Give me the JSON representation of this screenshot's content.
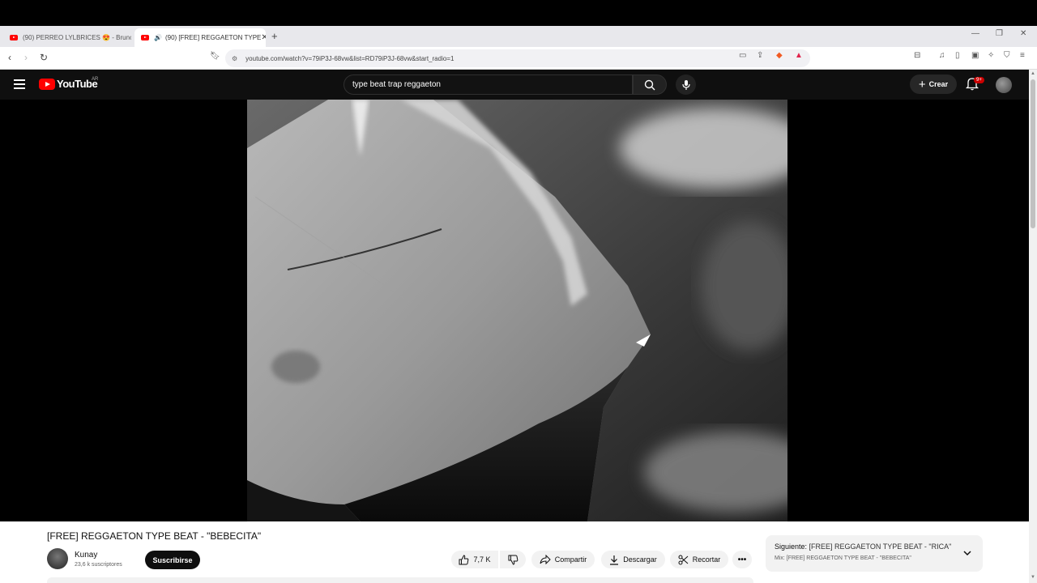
{
  "browser": {
    "tabs": [
      {
        "label": "(90) PERREO LYLBRICES 😍 - Bruno",
        "active": false
      },
      {
        "label": "(90) [FREE] REGGAETON TYPE",
        "active": true
      }
    ],
    "new_tab": "+",
    "url": "youtube.com/watch?v=79iP3J-68vw&list=RD79iP3J-68vw&start_radio=1"
  },
  "youtube": {
    "country": "AR",
    "logo_text": "YouTube",
    "search_query": "type beat trap reggaeton",
    "create_label": "Crear",
    "notifications_badge": "9+"
  },
  "video": {
    "title": "[FREE] REGGAETON TYPE BEAT - \"BEBECITA\"",
    "channel": "Kunay",
    "subscribers": "23,6 k suscriptores",
    "subscribe_label": "Suscribirse",
    "likes": "7,7 K",
    "share_label": "Compartir",
    "download_label": "Descargar",
    "clip_label": "Recortar"
  },
  "up_next": {
    "prefix": "Siguiente:",
    "title": "[FREE] REGGAETON TYPE BEAT - \"RICA\"",
    "mix": "Mix: [FREE] REGGAETON TYPE BEAT - \"BEBECITA\""
  },
  "colors": {
    "brand_red": "#ff0000",
    "masthead_bg": "#0f0f0f"
  }
}
